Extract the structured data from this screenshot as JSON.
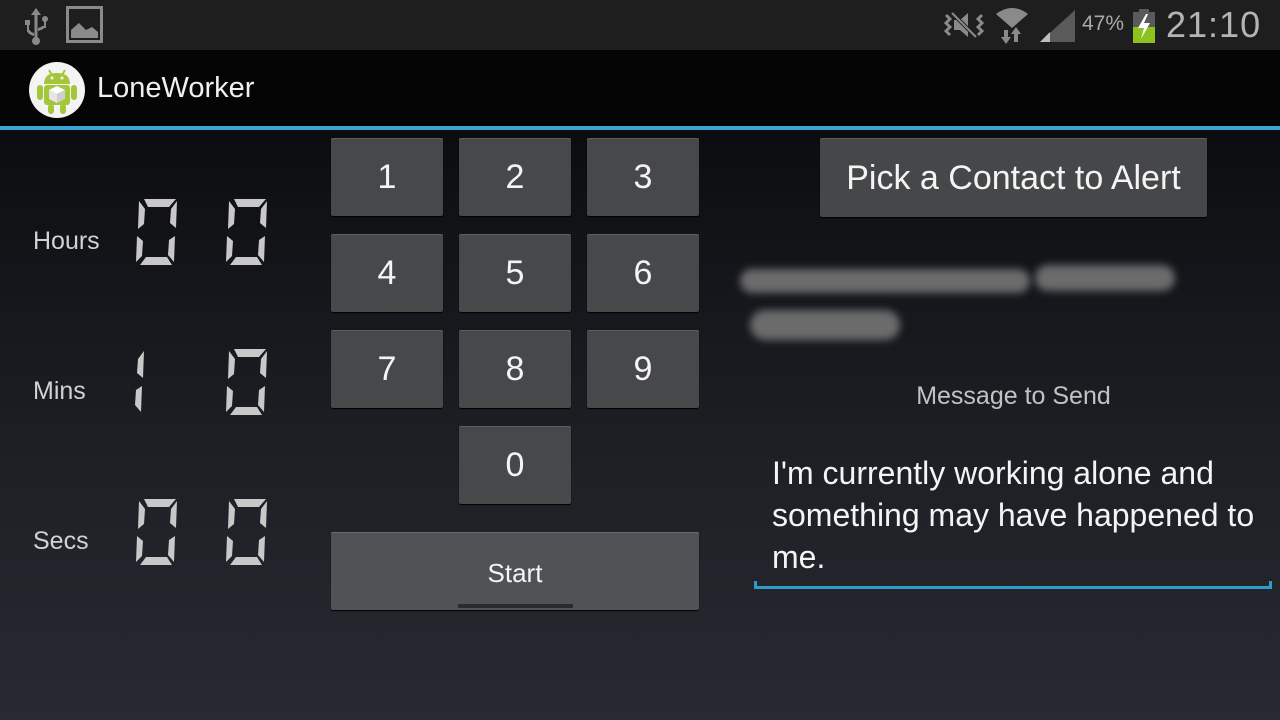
{
  "status_bar": {
    "icons_left": [
      "usb-icon",
      "gallery-icon"
    ],
    "icons_right": [
      "mute-icon",
      "wifi-icon",
      "signal-icon",
      "battery-charging-icon"
    ],
    "battery_percent": "47%",
    "time": "21:10",
    "battery_level": 0.47,
    "colors": {
      "battery_fill": "#8dc21f"
    }
  },
  "action_bar": {
    "app_icon": "android-app-icon",
    "title": "LoneWorker",
    "divider_color": "#3da5d2"
  },
  "timer": {
    "rows": [
      {
        "label": "Hours",
        "digits": [
          "0",
          "0"
        ]
      },
      {
        "label": "Mins",
        "digits": [
          "1",
          "0"
        ]
      },
      {
        "label": "Secs",
        "digits": [
          "0",
          "0"
        ]
      }
    ]
  },
  "keypad": {
    "keys": [
      "1",
      "2",
      "3",
      "4",
      "5",
      "6",
      "7",
      "8",
      "9",
      "0"
    ],
    "start_label": "Start"
  },
  "contact": {
    "pick_button_label": "Pick a Contact to Alert",
    "selected_contact": "[redacted]"
  },
  "message": {
    "label": "Message to Send",
    "value": "I'm currently working alone and something may have happened to me.",
    "accent_color": "#2f9bcb"
  }
}
